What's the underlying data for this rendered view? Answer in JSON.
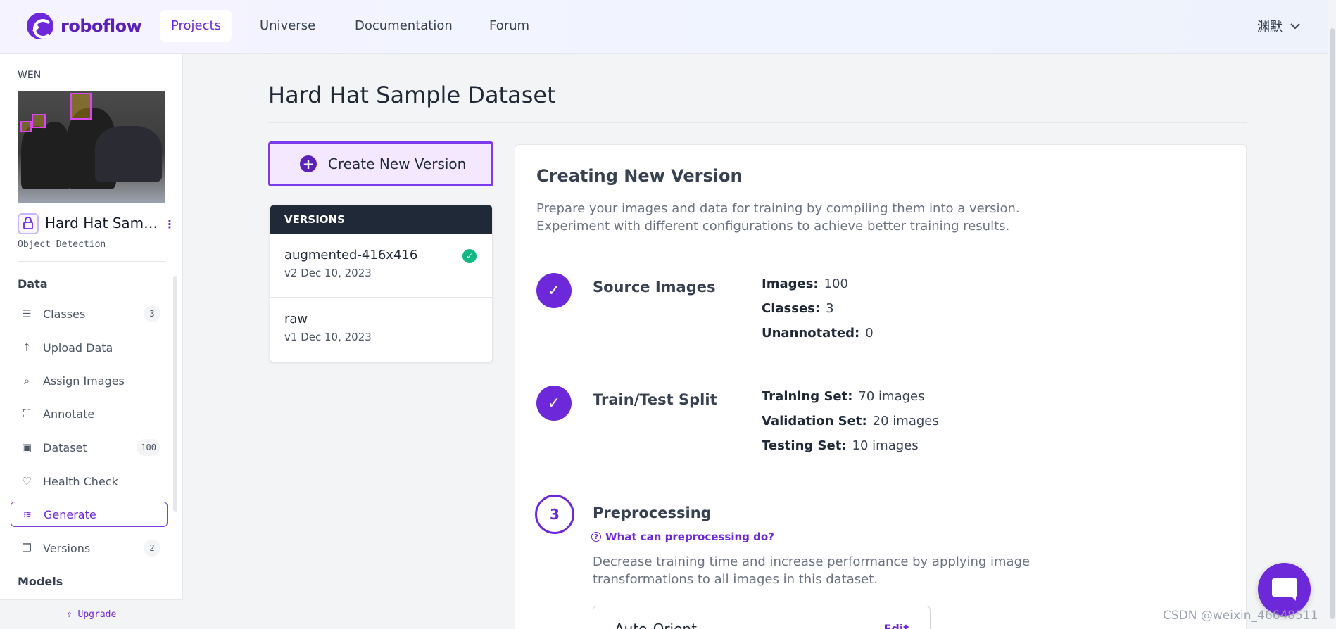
{
  "brand": {
    "name": "roboflow"
  },
  "nav": {
    "items": [
      {
        "label": "Projects"
      },
      {
        "label": "Universe"
      },
      {
        "label": "Documentation"
      },
      {
        "label": "Forum"
      }
    ],
    "user": "渊默"
  },
  "sidebar": {
    "workspace": "WEN",
    "project_name": "Hard Hat Samp...",
    "project_type": "Object Detection",
    "data_heading": "Data",
    "items": [
      {
        "label": "Classes",
        "badge": "3",
        "icon": "list-icon"
      },
      {
        "label": "Upload Data",
        "badge": "",
        "icon": "upload-icon"
      },
      {
        "label": "Assign Images",
        "badge": "",
        "icon": "search-icon"
      },
      {
        "label": "Annotate",
        "badge": "",
        "icon": "annotate-icon"
      },
      {
        "label": "Dataset",
        "badge": "100",
        "icon": "images-icon"
      },
      {
        "label": "Health Check",
        "badge": "",
        "icon": "heart-pulse-icon"
      },
      {
        "label": "Generate",
        "badge": "",
        "icon": "generate-icon"
      },
      {
        "label": "Versions",
        "badge": "2",
        "icon": "versions-icon"
      }
    ],
    "models_heading": "Models",
    "upgrade": "Upgrade"
  },
  "main": {
    "title": "Hard Hat Sample Dataset",
    "create_button": "Create New Version",
    "versions_heading": "VERSIONS",
    "versions": [
      {
        "name": "augmented-416x416",
        "date": "v2 Dec 10, 2023"
      },
      {
        "name": "raw",
        "date": "v1 Dec 10, 2023"
      }
    ]
  },
  "panel": {
    "title": "Creating New Version",
    "description_line1": "Prepare your images and data for training by compiling them into a version.",
    "description_line2": "Experiment with different configurations to achieve better training results.",
    "source": {
      "title": "Source Images",
      "images_label": "Images:",
      "images_value": "100",
      "classes_label": "Classes:",
      "classes_value": "3",
      "unannotated_label": "Unannotated:",
      "unannotated_value": "0"
    },
    "split": {
      "title": "Train/Test Split",
      "train_label": "Training Set:",
      "train_value": "70 images",
      "valid_label": "Validation Set:",
      "valid_value": "20 images",
      "test_label": "Testing Set:",
      "test_value": "10 images"
    },
    "preprocessing": {
      "step": "3",
      "title": "Preprocessing",
      "help": "What can preprocessing do?",
      "description_line1": "Decrease training time and increase performance by applying image",
      "description_line2": "transformations to all images in this dataset.",
      "card_label": "Auto-Orient",
      "card_edit": "Edit"
    }
  },
  "watermark": "CSDN @weixin_46648511",
  "colors": {
    "accent": "#6d28d9",
    "success": "#10b981",
    "dark": "#1f2937"
  }
}
